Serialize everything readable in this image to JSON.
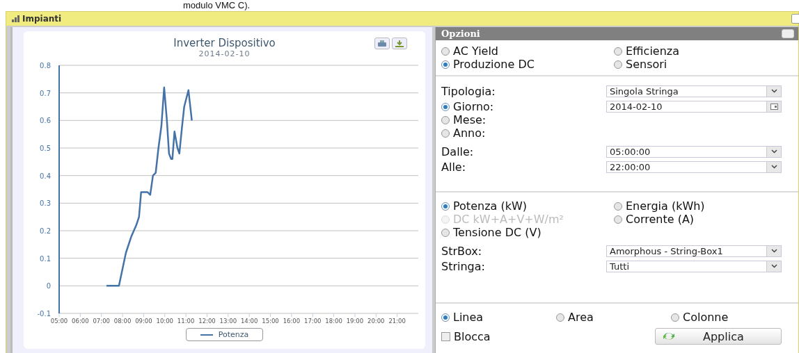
{
  "page_note": "modulo VMC C).",
  "window": {
    "title": "Impianti"
  },
  "chart_panel": {
    "subtitle": "2014-02-10",
    "chart_data": {
      "type": "line",
      "title": "Inverter Dispositivo",
      "grid": true,
      "xlim": [
        5,
        22
      ],
      "ylim": [
        -0.1,
        0.8
      ],
      "yticks": [
        -0.1,
        0,
        0.1,
        0.2,
        0.3,
        0.4,
        0.5,
        0.6,
        0.7,
        0.8
      ],
      "xticks": [
        {
          "value": 5,
          "label": "05:00"
        },
        {
          "value": 6,
          "label": "06:00"
        },
        {
          "value": 7,
          "label": "07:00"
        },
        {
          "value": 8,
          "label": "08:00"
        },
        {
          "value": 9,
          "label": "09:00"
        },
        {
          "value": 10,
          "label": "10:00"
        },
        {
          "value": 11,
          "label": "11:00"
        },
        {
          "value": 12,
          "label": "12:00"
        },
        {
          "value": 13,
          "label": "13:00"
        },
        {
          "value": 14,
          "label": "14:00"
        },
        {
          "value": 15,
          "label": "15:00"
        },
        {
          "value": 16,
          "label": "16:00"
        },
        {
          "value": 17,
          "label": "17:00"
        },
        {
          "value": 18,
          "label": "18:00"
        },
        {
          "value": 19,
          "label": "19:00"
        },
        {
          "value": 20,
          "label": "20:00"
        },
        {
          "value": 21,
          "label": "21:00"
        }
      ],
      "x": [
        7.24,
        7.83,
        8.16,
        8.42,
        8.65,
        8.78,
        8.88,
        9.18,
        9.31,
        9.44,
        9.57,
        9.7,
        9.84,
        9.97,
        10.1,
        10.2,
        10.3,
        10.36,
        10.46,
        10.6,
        10.69,
        10.82,
        10.92,
        11.12,
        11.28
      ],
      "series": [
        {
          "name": "Potenza",
          "color": "#4572a7",
          "values": [
            0,
            0,
            0.12,
            0.18,
            0.22,
            0.25,
            0.34,
            0.34,
            0.33,
            0.4,
            0.41,
            0.5,
            0.58,
            0.72,
            0.6,
            0.48,
            0.46,
            0.46,
            0.56,
            0.5,
            0.48,
            0.58,
            0.65,
            0.71,
            0.6
          ]
        }
      ]
    }
  },
  "options_panel": {
    "title": "Opzioni",
    "report_types": [
      {
        "label": "AC Yield",
        "selected": false
      },
      {
        "label": "Efficienza",
        "selected": false
      },
      {
        "label": "Produzione DC",
        "selected": true
      },
      {
        "label": "Sensori",
        "selected": false
      }
    ],
    "tipologia": {
      "label": "Tipologia:",
      "value": "Singola Stringa"
    },
    "periods": [
      {
        "label": "Giorno:",
        "selected": true
      },
      {
        "label": "Mese:",
        "selected": false
      },
      {
        "label": "Anno:",
        "selected": false
      }
    ],
    "date": {
      "value": "2014-02-10"
    },
    "dalle": {
      "label": "Dalle:",
      "value": "05:00:00"
    },
    "alle": {
      "label": "Alle:",
      "value": "22:00:00"
    },
    "measures": [
      {
        "label": "Potenza (kW)",
        "selected": true,
        "disabled": false
      },
      {
        "label": "Energia (kWh)",
        "selected": false,
        "disabled": false
      },
      {
        "label": "DC kW+A+V+W/m²",
        "selected": false,
        "disabled": true
      },
      {
        "label": "Corrente (A)",
        "selected": false,
        "disabled": false
      },
      {
        "label": "Tensione DC (V)",
        "selected": false,
        "disabled": false
      }
    ],
    "strbox": {
      "label": "StrBox:",
      "value": "Amorphous - String-Box1"
    },
    "stringa": {
      "label": "Stringa:",
      "value": "Tutti"
    },
    "chart_types": [
      {
        "label": "Linea",
        "selected": true
      },
      {
        "label": "Area",
        "selected": false
      },
      {
        "label": "Colonne",
        "selected": false
      }
    ],
    "blocca": {
      "label": "Blocca",
      "checked": false
    },
    "apply_button": "Applica"
  }
}
